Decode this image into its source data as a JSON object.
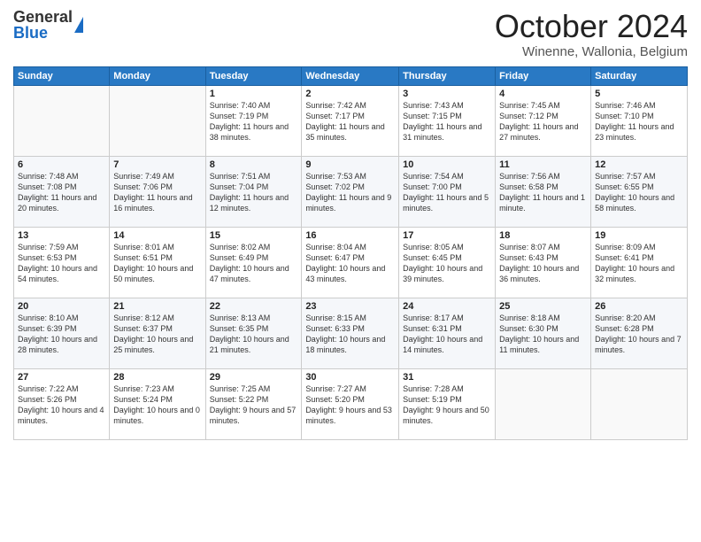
{
  "logo": {
    "general": "General",
    "blue": "Blue"
  },
  "header": {
    "month": "October 2024",
    "location": "Winenne, Wallonia, Belgium"
  },
  "weekdays": [
    "Sunday",
    "Monday",
    "Tuesday",
    "Wednesday",
    "Thursday",
    "Friday",
    "Saturday"
  ],
  "weeks": [
    [
      {
        "day": "",
        "info": ""
      },
      {
        "day": "",
        "info": ""
      },
      {
        "day": "1",
        "info": "Sunrise: 7:40 AM\nSunset: 7:19 PM\nDaylight: 11 hours and 38 minutes."
      },
      {
        "day": "2",
        "info": "Sunrise: 7:42 AM\nSunset: 7:17 PM\nDaylight: 11 hours and 35 minutes."
      },
      {
        "day": "3",
        "info": "Sunrise: 7:43 AM\nSunset: 7:15 PM\nDaylight: 11 hours and 31 minutes."
      },
      {
        "day": "4",
        "info": "Sunrise: 7:45 AM\nSunset: 7:12 PM\nDaylight: 11 hours and 27 minutes."
      },
      {
        "day": "5",
        "info": "Sunrise: 7:46 AM\nSunset: 7:10 PM\nDaylight: 11 hours and 23 minutes."
      }
    ],
    [
      {
        "day": "6",
        "info": "Sunrise: 7:48 AM\nSunset: 7:08 PM\nDaylight: 11 hours and 20 minutes."
      },
      {
        "day": "7",
        "info": "Sunrise: 7:49 AM\nSunset: 7:06 PM\nDaylight: 11 hours and 16 minutes."
      },
      {
        "day": "8",
        "info": "Sunrise: 7:51 AM\nSunset: 7:04 PM\nDaylight: 11 hours and 12 minutes."
      },
      {
        "day": "9",
        "info": "Sunrise: 7:53 AM\nSunset: 7:02 PM\nDaylight: 11 hours and 9 minutes."
      },
      {
        "day": "10",
        "info": "Sunrise: 7:54 AM\nSunset: 7:00 PM\nDaylight: 11 hours and 5 minutes."
      },
      {
        "day": "11",
        "info": "Sunrise: 7:56 AM\nSunset: 6:58 PM\nDaylight: 11 hours and 1 minute."
      },
      {
        "day": "12",
        "info": "Sunrise: 7:57 AM\nSunset: 6:55 PM\nDaylight: 10 hours and 58 minutes."
      }
    ],
    [
      {
        "day": "13",
        "info": "Sunrise: 7:59 AM\nSunset: 6:53 PM\nDaylight: 10 hours and 54 minutes."
      },
      {
        "day": "14",
        "info": "Sunrise: 8:01 AM\nSunset: 6:51 PM\nDaylight: 10 hours and 50 minutes."
      },
      {
        "day": "15",
        "info": "Sunrise: 8:02 AM\nSunset: 6:49 PM\nDaylight: 10 hours and 47 minutes."
      },
      {
        "day": "16",
        "info": "Sunrise: 8:04 AM\nSunset: 6:47 PM\nDaylight: 10 hours and 43 minutes."
      },
      {
        "day": "17",
        "info": "Sunrise: 8:05 AM\nSunset: 6:45 PM\nDaylight: 10 hours and 39 minutes."
      },
      {
        "day": "18",
        "info": "Sunrise: 8:07 AM\nSunset: 6:43 PM\nDaylight: 10 hours and 36 minutes."
      },
      {
        "day": "19",
        "info": "Sunrise: 8:09 AM\nSunset: 6:41 PM\nDaylight: 10 hours and 32 minutes."
      }
    ],
    [
      {
        "day": "20",
        "info": "Sunrise: 8:10 AM\nSunset: 6:39 PM\nDaylight: 10 hours and 28 minutes."
      },
      {
        "day": "21",
        "info": "Sunrise: 8:12 AM\nSunset: 6:37 PM\nDaylight: 10 hours and 25 minutes."
      },
      {
        "day": "22",
        "info": "Sunrise: 8:13 AM\nSunset: 6:35 PM\nDaylight: 10 hours and 21 minutes."
      },
      {
        "day": "23",
        "info": "Sunrise: 8:15 AM\nSunset: 6:33 PM\nDaylight: 10 hours and 18 minutes."
      },
      {
        "day": "24",
        "info": "Sunrise: 8:17 AM\nSunset: 6:31 PM\nDaylight: 10 hours and 14 minutes."
      },
      {
        "day": "25",
        "info": "Sunrise: 8:18 AM\nSunset: 6:30 PM\nDaylight: 10 hours and 11 minutes."
      },
      {
        "day": "26",
        "info": "Sunrise: 8:20 AM\nSunset: 6:28 PM\nDaylight: 10 hours and 7 minutes."
      }
    ],
    [
      {
        "day": "27",
        "info": "Sunrise: 7:22 AM\nSunset: 5:26 PM\nDaylight: 10 hours and 4 minutes."
      },
      {
        "day": "28",
        "info": "Sunrise: 7:23 AM\nSunset: 5:24 PM\nDaylight: 10 hours and 0 minutes."
      },
      {
        "day": "29",
        "info": "Sunrise: 7:25 AM\nSunset: 5:22 PM\nDaylight: 9 hours and 57 minutes."
      },
      {
        "day": "30",
        "info": "Sunrise: 7:27 AM\nSunset: 5:20 PM\nDaylight: 9 hours and 53 minutes."
      },
      {
        "day": "31",
        "info": "Sunrise: 7:28 AM\nSunset: 5:19 PM\nDaylight: 9 hours and 50 minutes."
      },
      {
        "day": "",
        "info": ""
      },
      {
        "day": "",
        "info": ""
      }
    ]
  ]
}
